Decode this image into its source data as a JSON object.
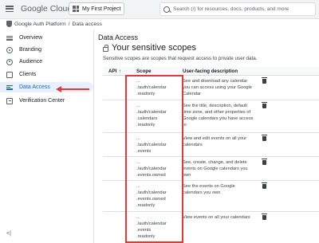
{
  "topbar": {
    "brand_google": "Google",
    "brand_cloud": "Cloud",
    "project_label": "My First Project",
    "search_placeholder": "Search (/) for resources, docs, products, and more"
  },
  "breadcrumb": {
    "parent": "Google Auth Platform",
    "separator": "/",
    "current": "Data access"
  },
  "sidebar": {
    "items": [
      {
        "label": "Overview",
        "icon": "list-icon"
      },
      {
        "label": "Branding",
        "icon": "palette-icon"
      },
      {
        "label": "Audience",
        "icon": "people-icon"
      },
      {
        "label": "Clients",
        "icon": "clients-icon"
      },
      {
        "label": "Data Access",
        "icon": "data-access-icon",
        "active": true
      },
      {
        "label": "Verification Center",
        "icon": "verification-icon"
      }
    ],
    "collapse_glyph": "<|"
  },
  "main": {
    "page_title": "Data Access",
    "section_title": "Your sensitive scopes",
    "description": "Sensitive scopes are scopes that request access to private user data.",
    "table": {
      "headers": {
        "api": "API",
        "sort_glyph": "↑",
        "scope": "Scope",
        "user_desc": "User-facing description"
      },
      "rows": [
        {
          "scope": "...\n./auth/calendar\n.readonly",
          "description": "See and download any calendar you can access using your Google Calendar"
        },
        {
          "scope": "...\n./auth/calendar\n.calendars\n.readonly",
          "description": "See the title, description, default time zone, and other properties of Google calendars you have access to"
        },
        {
          "scope": "...\n./auth/calendar\n.events",
          "description": "View and edit events on all your calendars"
        },
        {
          "scope": "...\n./auth/calendar\n.events.owned",
          "description": "See, create, change, and delete events on Google calendars you own"
        },
        {
          "scope": "...\n./auth/calendar\n.events.owned\n.readonly",
          "description": "See the events on Google calendars you own"
        },
        {
          "scope": "...\n./auth/calendar\n.events\n.readonly",
          "description": "View events on all your calendars"
        }
      ]
    }
  },
  "colors": {
    "accent": "#1967d2",
    "annotation": "#e53935"
  }
}
